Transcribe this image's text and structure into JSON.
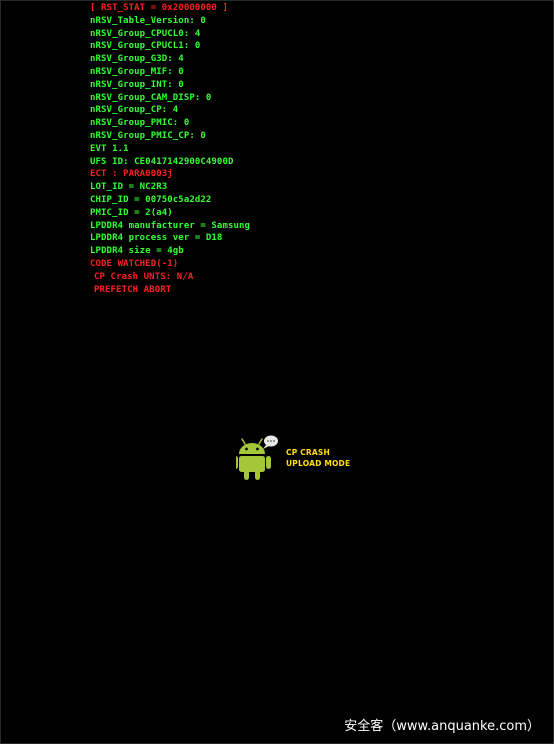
{
  "log_lines": [
    {
      "text": "[ RST_STAT = 0x20000000 ]",
      "color": "red"
    },
    {
      "text": "nRSV_Table_Version: 0",
      "color": "green"
    },
    {
      "text": "nRSV_Group_CPUCL0: 4",
      "color": "green"
    },
    {
      "text": "nRSV_Group_CPUCL1: 0",
      "color": "green"
    },
    {
      "text": "nRSV_Group_G3D: 4",
      "color": "green"
    },
    {
      "text": "nRSV_Group_MIF: 0",
      "color": "green"
    },
    {
      "text": "nRSV_Group_INT: 0",
      "color": "green"
    },
    {
      "text": "nRSV_Group_CAM_DISP: 0",
      "color": "green"
    },
    {
      "text": "nRSV_Group_CP: 4",
      "color": "green"
    },
    {
      "text": "nRSV_Group_PMIC: 0",
      "color": "green"
    },
    {
      "text": "nRSV_Group_PMIC_CP: 0",
      "color": "green"
    },
    {
      "text": "EVT 1.1",
      "color": "green"
    },
    {
      "text": "UFS ID: CE0417142900C4900D",
      "color": "green"
    },
    {
      "text": "ECT : PARA0003j",
      "color": "red"
    },
    {
      "text": "LOT_ID = NC2R3",
      "color": "green"
    },
    {
      "text": "CHIP_ID = 00750c5a2d22",
      "color": "green"
    },
    {
      "text": "PMIC_ID = 2(a4)",
      "color": "green"
    },
    {
      "text": "LPDDR4 manufacturer = Samsung",
      "color": "green"
    },
    {
      "text": "LPDDR4 process ver = D18",
      "color": "green"
    },
    {
      "text": "LPDDR4 size = 4gb",
      "color": "green"
    },
    {
      "text": "CODE WATCHED(-1)",
      "color": "red"
    },
    {
      "text": "CP Crash UNTS: N/A",
      "color": "red",
      "indent": true
    },
    {
      "text": "PREFETCH ABORT",
      "color": "red",
      "indent": true
    }
  ],
  "status": {
    "line1": "CP CRASH",
    "line2": "UPLOAD MODE"
  },
  "watermark": "安全客（www.anquanke.com）",
  "colors": {
    "background": "#000000",
    "log_green": "#33ff33",
    "log_red": "#ff2020",
    "status_yellow": "#ffe000",
    "android_green": "#a4c639"
  },
  "icons": {
    "mascot": "android-robot-icon",
    "bubble": "speech-bubble-icon"
  }
}
